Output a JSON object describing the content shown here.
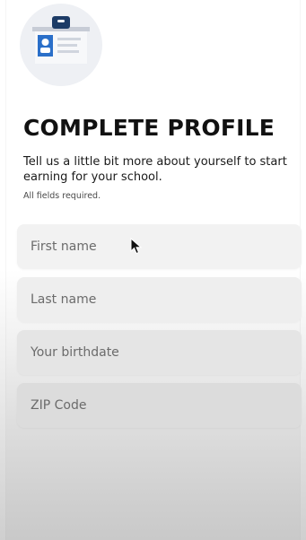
{
  "header": {
    "icon": "id-badge-icon",
    "title": "COMPLETE PROFILE",
    "subtitle": "Tell us a little bit more about yourself to start earning for your school.",
    "required_note": "All fields required."
  },
  "form": {
    "first_name": {
      "placeholder": "First name",
      "value": ""
    },
    "last_name": {
      "placeholder": "Last name",
      "value": ""
    },
    "birthdate": {
      "placeholder": "Your birthdate",
      "value": ""
    },
    "zip_code": {
      "placeholder": "ZIP Code",
      "value": ""
    }
  },
  "colors": {
    "badge_navy": "#1c3b66",
    "badge_blue": "#2a6fc9",
    "badge_bg": "#eef0f4",
    "field_bg": "#f2f2f2",
    "title": "#111111"
  }
}
